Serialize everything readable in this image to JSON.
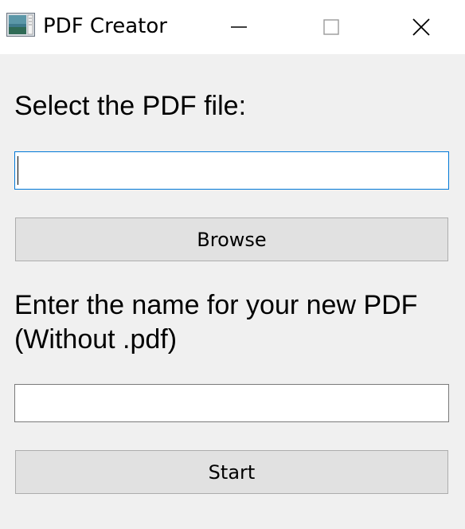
{
  "window": {
    "title": "PDF Creator",
    "controls": {
      "minimize": "minimize-icon",
      "maximize": "maximize-icon",
      "close": "close-icon"
    }
  },
  "form": {
    "file_label": "Select the PDF file:",
    "file_input_value": "",
    "browse_label": "Browse",
    "name_label_line1": "Enter the name for your new PDF",
    "name_label_line2": "(Without .pdf)",
    "name_input_value": "",
    "start_label": "Start"
  },
  "colors": {
    "background": "#f0f0f0",
    "titlebar": "#ffffff",
    "focus_border": "#0078d7",
    "button_face": "#e1e1e1",
    "button_border": "#adadad"
  }
}
